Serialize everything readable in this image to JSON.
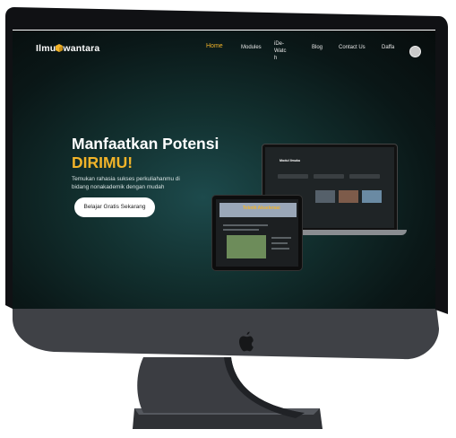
{
  "nav": {
    "logo_left": "Ilmu",
    "logo_right": "wantara",
    "items": [
      "Home",
      "Modules",
      "iDe-Watc\nh",
      "Blog",
      "Contact Us"
    ],
    "user": "Daffa"
  },
  "hero": {
    "title": "Manfaatkan Potensi",
    "accent": "DIRIMU!",
    "subtitle": "Temukan rahasia sukses perkuliahanmu di bidang nonakademik dengan mudah",
    "cta": "Belajar Gratis Sekarang"
  },
  "mockups": {
    "laptop_title": "Modul Ilmuku",
    "tablet_title": "Teknik Akselerasi"
  },
  "colors": {
    "accent": "#f2b429",
    "bezel": "#101114",
    "chin": "#3f4146"
  }
}
